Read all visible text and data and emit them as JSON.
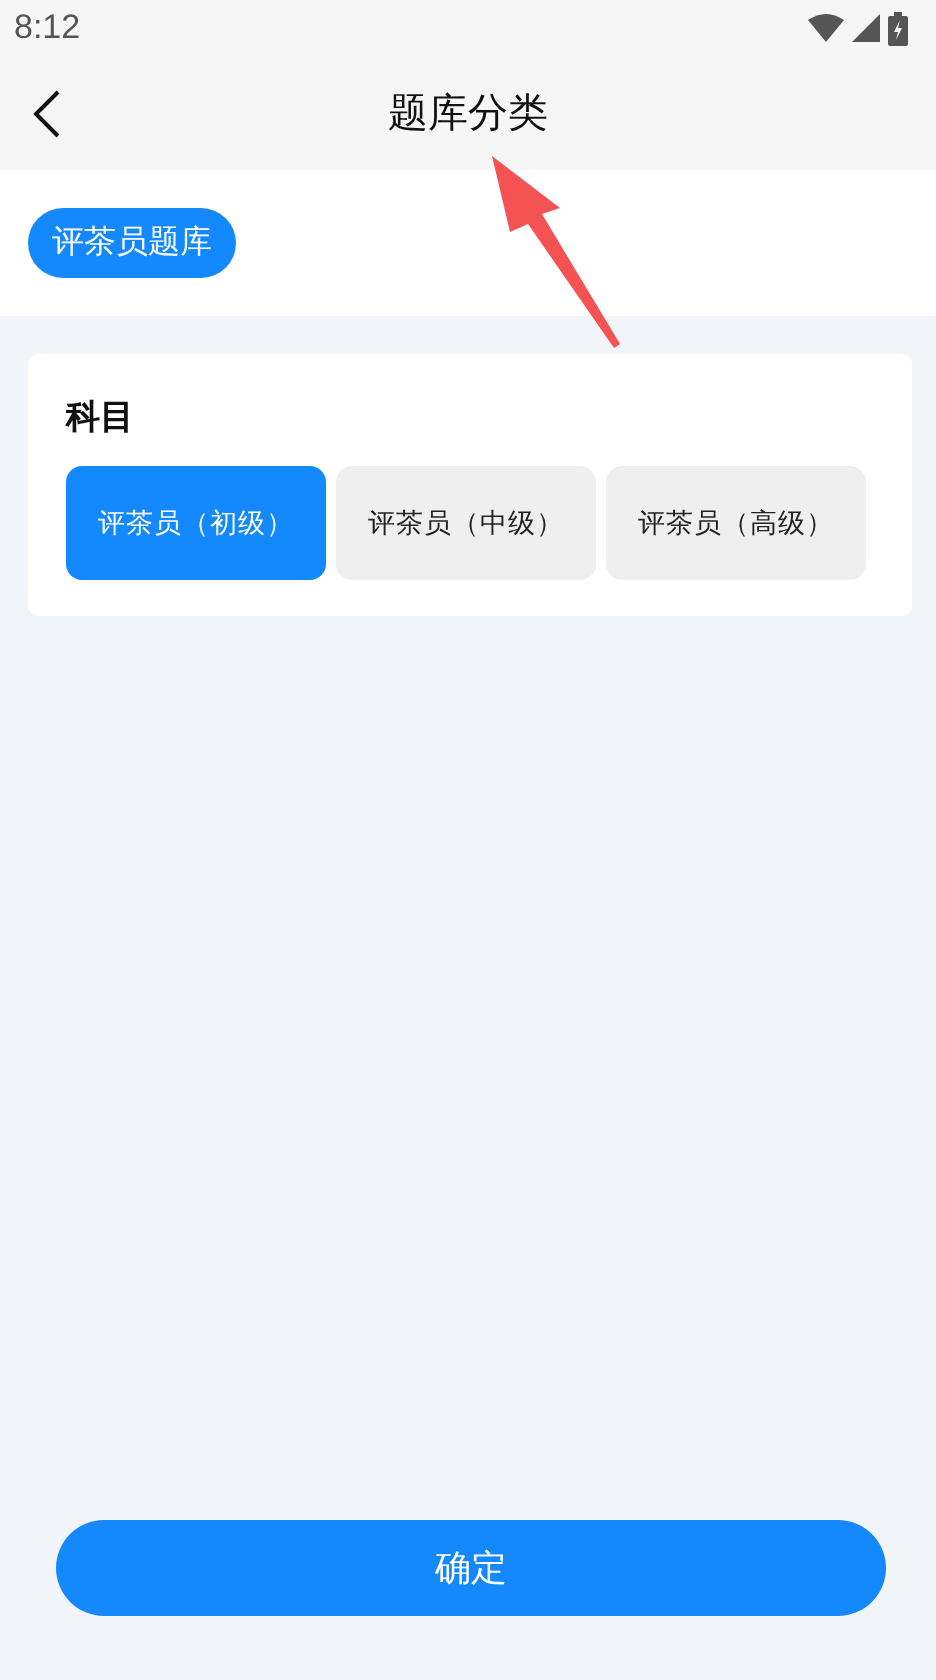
{
  "status_bar": {
    "time": "8:12"
  },
  "nav": {
    "title": "题库分类"
  },
  "bank_tag": {
    "label": "评茶员题库",
    "selected": true
  },
  "subject": {
    "heading": "科目",
    "options": [
      {
        "label": "评茶员（初级）",
        "selected": true
      },
      {
        "label": "评茶员（中级）",
        "selected": false
      },
      {
        "label": "评茶员（高级）",
        "selected": false
      }
    ]
  },
  "confirm_button": {
    "label": "确定"
  }
}
